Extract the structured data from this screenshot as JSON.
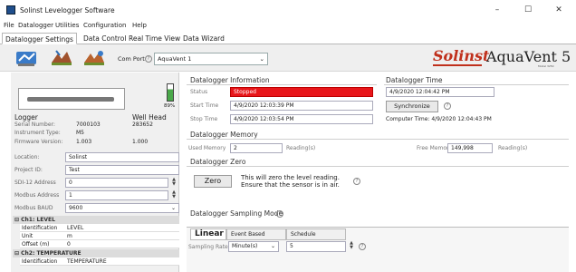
{
  "window": {
    "title": "Solinst Levelogger Software",
    "minimize": "–",
    "maximize": "☐",
    "close": "✕"
  },
  "menu": [
    "File",
    "Datalogger",
    "Utilities",
    "Configuration",
    "Help"
  ],
  "tabs": [
    "Datalogger Settings",
    "Data Control",
    "Real Time View",
    "Data Wizard"
  ],
  "toolbar": {
    "com_port_label": "Com Port:",
    "com_port_value": "AquaVent 1",
    "brand": "Solinst",
    "product": "AquaVent 5",
    "product_sub": "Model 3250",
    "icons": [
      "datalogger-icon",
      "logger-download-icon",
      "logger-settings-icon"
    ]
  },
  "logger": {
    "battery": "89%",
    "battery_level": 0.89,
    "heading": "Logger",
    "well_head_heading": "Well Head",
    "serial_label": "Serial Number:",
    "serial_value": "7000103",
    "well_head_serial": "283652",
    "instrument_label": "Instrument Type:",
    "instrument_value": "M5",
    "firmware_label": "Firmware Version:",
    "firmware_value": "1.003",
    "well_head_firmware": "1.000"
  },
  "project_fields": [
    {
      "label": "Location:",
      "value": "Solinst"
    },
    {
      "label": "Project ID:",
      "value": "Test"
    },
    {
      "label": "SDI-12 Address",
      "value": "0",
      "spin": true
    },
    {
      "label": "Modbus Address",
      "value": "1",
      "spin": true
    },
    {
      "label": "Modbus BAUD",
      "value": "9600",
      "spin": false,
      "dropdown": true
    }
  ],
  "channels": {
    "ch1_title": "Ch1: LEVEL",
    "ch1_rows": [
      {
        "k": "Identification",
        "v": "LEVEL"
      },
      {
        "k": "Unit",
        "v": "m"
      },
      {
        "k": "Offset (m)",
        "v": "0"
      }
    ],
    "ch2_title": "Ch2: TEMPERATURE",
    "ch2_rows": [
      {
        "k": "Identification",
        "v": "TEMPERATURE"
      }
    ]
  },
  "info": {
    "title": "Datalogger Information",
    "status_label": "Status",
    "status_value": "Stopped",
    "start_label": "Start Time",
    "start_value": "4/9/2020 12:03:39 PM",
    "stop_label": "Stop Time",
    "stop_value": "4/9/2020 12:03:54 PM"
  },
  "time": {
    "title": "Datalogger Time",
    "value": "4/9/2020 12:04:42 PM",
    "sync_label": "Synchronize",
    "computer_time": "Computer Time: 4/9/2020 12:04:43 PM"
  },
  "memory": {
    "title": "Datalogger Memory",
    "used_label": "Used Memory",
    "used_value": "2",
    "used_unit": "Reading(s)",
    "free_label": "Free Memory",
    "free_value": "149,998",
    "free_unit": "Reading(s)"
  },
  "zero": {
    "title": "Datalogger Zero",
    "button": "Zero",
    "text1": "This will zero the level reading.",
    "text2": "Ensure that the sensor is in air."
  },
  "sampling": {
    "title": "Datalogger Sampling Mode",
    "tabs": [
      "Linear",
      "Event Based",
      "Schedule"
    ],
    "rate_label": "Sampling Rate",
    "rate_unit": "Minute(s)",
    "rate_value": "5"
  }
}
